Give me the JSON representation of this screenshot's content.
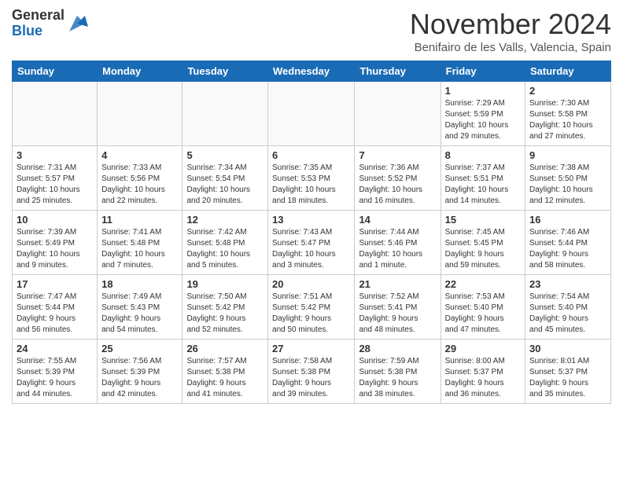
{
  "header": {
    "logo_line1": "General",
    "logo_line2": "Blue",
    "month_title": "November 2024",
    "location": "Benifairo de les Valls, Valencia, Spain"
  },
  "calendar": {
    "columns": [
      "Sunday",
      "Monday",
      "Tuesday",
      "Wednesday",
      "Thursday",
      "Friday",
      "Saturday"
    ],
    "weeks": [
      [
        {
          "day": "",
          "info": ""
        },
        {
          "day": "",
          "info": ""
        },
        {
          "day": "",
          "info": ""
        },
        {
          "day": "",
          "info": ""
        },
        {
          "day": "",
          "info": ""
        },
        {
          "day": "1",
          "info": "Sunrise: 7:29 AM\nSunset: 5:59 PM\nDaylight: 10 hours\nand 29 minutes."
        },
        {
          "day": "2",
          "info": "Sunrise: 7:30 AM\nSunset: 5:58 PM\nDaylight: 10 hours\nand 27 minutes."
        }
      ],
      [
        {
          "day": "3",
          "info": "Sunrise: 7:31 AM\nSunset: 5:57 PM\nDaylight: 10 hours\nand 25 minutes."
        },
        {
          "day": "4",
          "info": "Sunrise: 7:33 AM\nSunset: 5:56 PM\nDaylight: 10 hours\nand 22 minutes."
        },
        {
          "day": "5",
          "info": "Sunrise: 7:34 AM\nSunset: 5:54 PM\nDaylight: 10 hours\nand 20 minutes."
        },
        {
          "day": "6",
          "info": "Sunrise: 7:35 AM\nSunset: 5:53 PM\nDaylight: 10 hours\nand 18 minutes."
        },
        {
          "day": "7",
          "info": "Sunrise: 7:36 AM\nSunset: 5:52 PM\nDaylight: 10 hours\nand 16 minutes."
        },
        {
          "day": "8",
          "info": "Sunrise: 7:37 AM\nSunset: 5:51 PM\nDaylight: 10 hours\nand 14 minutes."
        },
        {
          "day": "9",
          "info": "Sunrise: 7:38 AM\nSunset: 5:50 PM\nDaylight: 10 hours\nand 12 minutes."
        }
      ],
      [
        {
          "day": "10",
          "info": "Sunrise: 7:39 AM\nSunset: 5:49 PM\nDaylight: 10 hours\nand 9 minutes."
        },
        {
          "day": "11",
          "info": "Sunrise: 7:41 AM\nSunset: 5:48 PM\nDaylight: 10 hours\nand 7 minutes."
        },
        {
          "day": "12",
          "info": "Sunrise: 7:42 AM\nSunset: 5:48 PM\nDaylight: 10 hours\nand 5 minutes."
        },
        {
          "day": "13",
          "info": "Sunrise: 7:43 AM\nSunset: 5:47 PM\nDaylight: 10 hours\nand 3 minutes."
        },
        {
          "day": "14",
          "info": "Sunrise: 7:44 AM\nSunset: 5:46 PM\nDaylight: 10 hours\nand 1 minute."
        },
        {
          "day": "15",
          "info": "Sunrise: 7:45 AM\nSunset: 5:45 PM\nDaylight: 9 hours\nand 59 minutes."
        },
        {
          "day": "16",
          "info": "Sunrise: 7:46 AM\nSunset: 5:44 PM\nDaylight: 9 hours\nand 58 minutes."
        }
      ],
      [
        {
          "day": "17",
          "info": "Sunrise: 7:47 AM\nSunset: 5:44 PM\nDaylight: 9 hours\nand 56 minutes."
        },
        {
          "day": "18",
          "info": "Sunrise: 7:49 AM\nSunset: 5:43 PM\nDaylight: 9 hours\nand 54 minutes."
        },
        {
          "day": "19",
          "info": "Sunrise: 7:50 AM\nSunset: 5:42 PM\nDaylight: 9 hours\nand 52 minutes."
        },
        {
          "day": "20",
          "info": "Sunrise: 7:51 AM\nSunset: 5:42 PM\nDaylight: 9 hours\nand 50 minutes."
        },
        {
          "day": "21",
          "info": "Sunrise: 7:52 AM\nSunset: 5:41 PM\nDaylight: 9 hours\nand 48 minutes."
        },
        {
          "day": "22",
          "info": "Sunrise: 7:53 AM\nSunset: 5:40 PM\nDaylight: 9 hours\nand 47 minutes."
        },
        {
          "day": "23",
          "info": "Sunrise: 7:54 AM\nSunset: 5:40 PM\nDaylight: 9 hours\nand 45 minutes."
        }
      ],
      [
        {
          "day": "24",
          "info": "Sunrise: 7:55 AM\nSunset: 5:39 PM\nDaylight: 9 hours\nand 44 minutes."
        },
        {
          "day": "25",
          "info": "Sunrise: 7:56 AM\nSunset: 5:39 PM\nDaylight: 9 hours\nand 42 minutes."
        },
        {
          "day": "26",
          "info": "Sunrise: 7:57 AM\nSunset: 5:38 PM\nDaylight: 9 hours\nand 41 minutes."
        },
        {
          "day": "27",
          "info": "Sunrise: 7:58 AM\nSunset: 5:38 PM\nDaylight: 9 hours\nand 39 minutes."
        },
        {
          "day": "28",
          "info": "Sunrise: 7:59 AM\nSunset: 5:38 PM\nDaylight: 9 hours\nand 38 minutes."
        },
        {
          "day": "29",
          "info": "Sunrise: 8:00 AM\nSunset: 5:37 PM\nDaylight: 9 hours\nand 36 minutes."
        },
        {
          "day": "30",
          "info": "Sunrise: 8:01 AM\nSunset: 5:37 PM\nDaylight: 9 hours\nand 35 minutes."
        }
      ]
    ]
  }
}
